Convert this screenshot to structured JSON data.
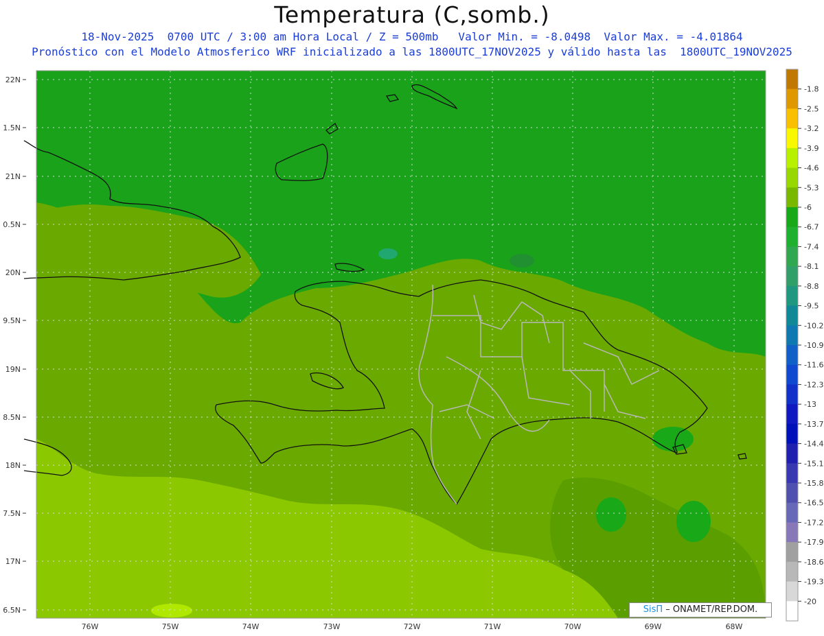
{
  "header": {
    "title": "Temperatura (C,somb.)",
    "line1": "18-Nov-2025  0700 UTC / 3:00 am Hora Local / Z = 500mb   Valor Min. = -8.0498  Valor Max. = -4.01864",
    "line2": "Pronóstico con el Modelo Atmosferico WRF inicializado a las 1800UTC_17NOV2025 y válido hasta las  1800UTC_19NOV2025"
  },
  "axes": {
    "lat_labels": [
      "22N",
      "1.5N",
      "21N",
      "0.5N",
      "20N",
      "9.5N",
      "19N",
      "8.5N",
      "18N",
      "7.5N",
      "17N",
      "6.5N"
    ],
    "lon_labels": [
      "76W",
      "75W",
      "74W",
      "73W",
      "72W",
      "71W",
      "70W",
      "69W",
      "68W"
    ]
  },
  "colorbar": {
    "labels": [
      "-1.8",
      "-2.5",
      "-3.2",
      "-3.9",
      "-4.6",
      "-5.3",
      "-6",
      "-6.7",
      "-7.4",
      "-8.1",
      "-8.8",
      "-9.5",
      "-10.2",
      "-10.9",
      "-11.6",
      "-12.3",
      "-13",
      "-13.7",
      "-14.4",
      "-15.1",
      "-15.8",
      "-16.5",
      "-17.2",
      "-17.9",
      "-18.6",
      "-19.3",
      "-20"
    ],
    "colors": [
      "#c07800",
      "#e09800",
      "#f8c000",
      "#f8f800",
      "#b8f000",
      "#98d800",
      "#78b800",
      "#18a818",
      "#20b030",
      "#30a850",
      "#30a068",
      "#209880",
      "#108898",
      "#1078b0",
      "#1060c8",
      "#1048d0",
      "#1030c8",
      "#1018c0",
      "#0010b8",
      "#2020b0",
      "#3838b0",
      "#5050b0",
      "#6868b8",
      "#8878b8",
      "#a0a0a0",
      "#b8b8b8",
      "#d8d8d8",
      "#ffffff"
    ]
  },
  "credit": {
    "brand": "SisΠ",
    "text": " – ONAMET/REP.DOM."
  }
}
